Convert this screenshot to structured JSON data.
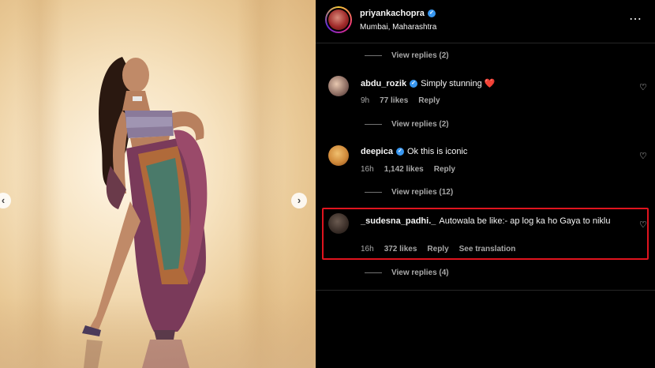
{
  "post": {
    "username": "priyankachopra",
    "location": "Mumbai, Maharashtra",
    "more_icon": "⋯"
  },
  "view_replies": [
    {
      "label": "View replies (2)"
    },
    {
      "label": "View replies (2)"
    },
    {
      "label": "View replies (12)"
    },
    {
      "label": "View replies (4)"
    }
  ],
  "comments": [
    {
      "user": "abdu_rozik",
      "verified": true,
      "text": "Simply stunning ❤️",
      "time": "9h",
      "likes": "77 likes",
      "reply": "Reply"
    },
    {
      "user": "deepica",
      "verified": true,
      "text": "Ok this is iconic",
      "time": "16h",
      "likes": "1,142 likes",
      "reply": "Reply"
    },
    {
      "user": "_sudesna_padhi._",
      "verified": false,
      "text": "Autowala be like:- ap log ka ho Gaya to niklu",
      "time": "16h",
      "likes": "372 likes",
      "reply": "Reply",
      "translate": "See translation"
    }
  ],
  "colors": {
    "background": "#000000",
    "muted_text": "#a8a8a8",
    "verified_blue": "#3897f0",
    "highlight_red": "#e0141e"
  },
  "icons": {
    "verified": "✓",
    "heart": "♡",
    "prev": "‹",
    "next": "›"
  }
}
